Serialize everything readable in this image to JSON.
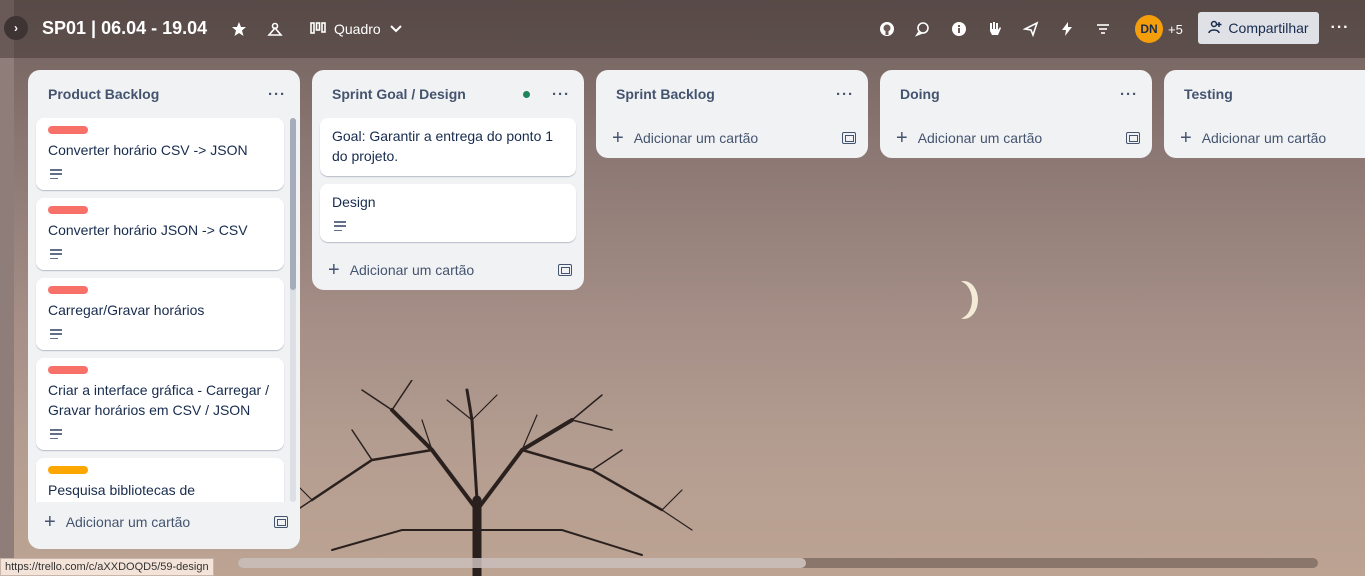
{
  "header": {
    "board_title": "SP01 | 06.04 - 19.04",
    "view_label": "Quadro",
    "avatar_initials": "DN",
    "member_extra": "+5",
    "share_label": "Compartilhar",
    "icons": [
      "star-icon",
      "workspace-visibility-icon",
      "board-view-icon",
      "github-icon",
      "comments-icon",
      "info-icon",
      "power-up-icon",
      "send-icon",
      "automation-icon",
      "filter-icon"
    ]
  },
  "lists": [
    {
      "title": "Product Backlog",
      "cards": [
        {
          "label_color": "#f87168",
          "title": "Converter horário CSV -> JSON",
          "has_description": true
        },
        {
          "label_color": "#f87168",
          "title": "Converter horário JSON -> CSV",
          "has_description": true
        },
        {
          "label_color": "#f87168",
          "title": "Carregar/Gravar horários",
          "has_description": true
        },
        {
          "label_color": "#f87168",
          "title": "Criar a interface gráfica - Carregar / Gravar horários em CSV / JSON",
          "has_description": true
        },
        {
          "label_color": "#fca700",
          "title": "Pesquisa bibliotecas de",
          "has_description": false
        }
      ],
      "add_label": "Adicionar um cartão"
    },
    {
      "title": "Sprint Goal / Design",
      "cards": [
        {
          "label_color": "",
          "title": "Goal: Garantir a entrega do ponto 1 do projeto.",
          "has_description": false
        },
        {
          "label_color": "",
          "title": "Design",
          "has_description": true
        }
      ],
      "add_label": "Adicionar um cartão"
    },
    {
      "title": "Sprint Backlog",
      "cards": [],
      "add_label": "Adicionar um cartão"
    },
    {
      "title": "Doing",
      "cards": [],
      "add_label": "Adicionar um cartão"
    },
    {
      "title": "Testing",
      "cards": [],
      "add_label": "Adicionar um cartão"
    }
  ],
  "status_bar": {
    "url": "https://trello.com/c/aXXDOQD5/59-design"
  },
  "colors": {
    "label_red": "#f87168",
    "label_orange": "#fca700",
    "watch_dot": "#1f845a",
    "avatar": "#f59e0b"
  }
}
